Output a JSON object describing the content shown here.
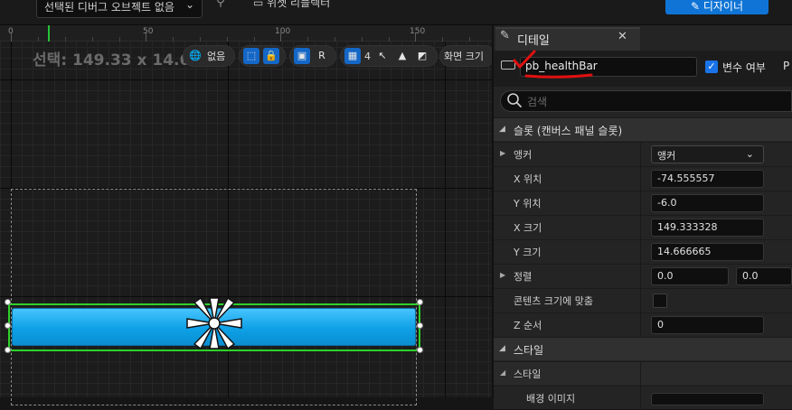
{
  "topbar": {
    "debug_select": "선택된 디버그 오브젝트 없음",
    "debug_select_chevron": "chevron-down-icon",
    "widget_reflector": "위젯 리플렉터",
    "designer_button": "디자이너"
  },
  "viewport": {
    "ruler_labels": [
      "0",
      "50",
      "100",
      "150"
    ],
    "selection_size": "선택: 149.33 x 14.67",
    "world_label": "없음",
    "r_label": "R",
    "grid_value": "4",
    "screen_size_label": "화면 크기"
  },
  "details": {
    "title": "디테일",
    "close_glyph": "✕",
    "widget_name": "pb_healthBar",
    "is_variable_label": "변수 여부",
    "is_variable_checked": true,
    "extra_label": "P",
    "search_placeholder": "검색",
    "sections": {
      "slot": "슬롯 (캔버스 패널 슬롯)",
      "style_header": "스타일",
      "style_sub": "스타일",
      "bg_image": "배경 이미지"
    },
    "rows": {
      "anchor": {
        "label": "앵커",
        "value": "앵커"
      },
      "pos_x": {
        "label": "X 위치",
        "value": "-74.555557"
      },
      "pos_y": {
        "label": "Y 위치",
        "value": "-6.0"
      },
      "size_x": {
        "label": "X 크기",
        "value": "149.333328"
      },
      "size_y": {
        "label": "Y 크기",
        "value": "14.666665"
      },
      "alignment": {
        "label": "정렬",
        "value_x": "0.0",
        "value_y": "0.0"
      },
      "size_to_content": {
        "label": "콘텐츠 크기에 맞춤"
      },
      "z_order": {
        "label": "Z 순서",
        "value": "0"
      }
    }
  },
  "colors": {
    "accent_blue": "#0f74d6",
    "progress_fill": "#0ea0e6",
    "selection_green": "#2ed12a",
    "annotation_red": "#e01010"
  }
}
